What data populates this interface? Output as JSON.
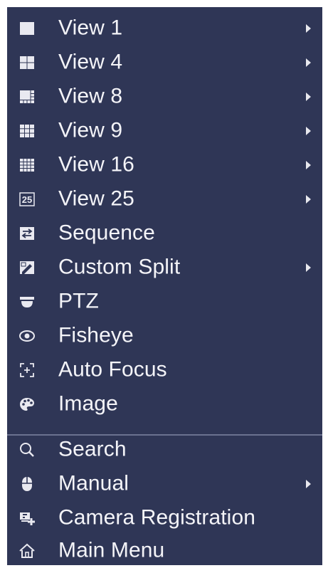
{
  "menu": {
    "items": [
      {
        "label": "View 1",
        "icon": "view1-icon"
      },
      {
        "label": "View 4",
        "icon": "view4-icon"
      },
      {
        "label": "View 8",
        "icon": "view8-icon"
      },
      {
        "label": "View 9",
        "icon": "view9-icon"
      },
      {
        "label": "View 16",
        "icon": "view16-icon"
      },
      {
        "label": "View 25",
        "icon": "view25-icon",
        "icon_text": "25"
      },
      {
        "label": "Sequence",
        "icon": "sequence-icon"
      },
      {
        "label": "Custom Split",
        "icon": "custom-split-icon"
      },
      {
        "label": "PTZ",
        "icon": "ptz-icon"
      },
      {
        "label": "Fisheye",
        "icon": "fisheye-icon"
      },
      {
        "label": "Auto Focus",
        "icon": "auto-focus-icon"
      },
      {
        "label": "Image",
        "icon": "image-palette-icon"
      },
      {
        "label": "Search",
        "icon": "search-icon"
      },
      {
        "label": "Manual",
        "icon": "mouse-icon"
      },
      {
        "label": "Camera Registration",
        "icon": "camera-registration-icon"
      },
      {
        "label": "Main Menu",
        "icon": "home-icon"
      }
    ]
  },
  "colors": {
    "background": "#2f3656",
    "text": "#f4f4f8",
    "divider": "#6b7290"
  }
}
